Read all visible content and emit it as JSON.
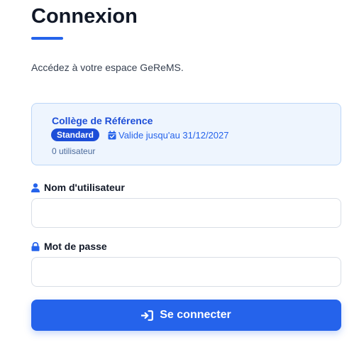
{
  "header": {
    "title": "Connexion",
    "subtitle": "Accédez à votre espace GeReMS."
  },
  "license_card": {
    "school_name": "Collège de Référence",
    "plan_badge": "Standard",
    "validity": "Valide jusqu'au 31/12/2027",
    "user_count": "0 utilisateur"
  },
  "form": {
    "username_label": "Nom d'utilisateur",
    "username_value": "",
    "password_label": "Mot de passe",
    "password_value": "",
    "submit_label": "Se connecter"
  },
  "icons": {
    "username": "user-icon",
    "password": "lock-icon",
    "validity": "calendar-check-icon",
    "submit": "sign-in-icon"
  },
  "colors": {
    "accent": "#2563eb",
    "card_background": "#eef5fe",
    "card_border": "#bcd6f7",
    "badge": "#1d4ed8",
    "text_dark": "#111827"
  }
}
